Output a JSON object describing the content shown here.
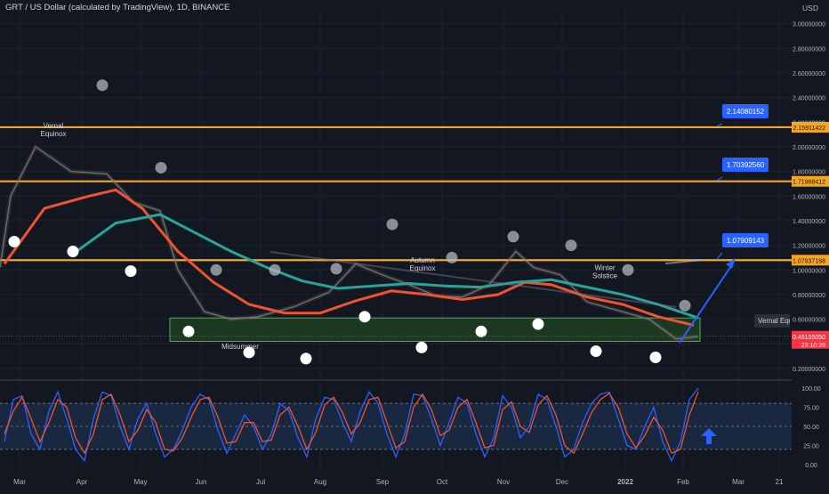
{
  "header": {
    "title": "GRT / US Dollar (calculated by TradingView), 1D, BINANCE",
    "currency": "USD"
  },
  "colors": {
    "background": "#131722",
    "resistance": "#f5a623",
    "callout": "#2962ff",
    "zone_fill": "#1e4620",
    "zone_border": "#4caf50",
    "ema_fast": "#f0532f",
    "ema_slow": "#26a69a",
    "stoch_k": "#2962ff",
    "stoch_d": "#f0532f",
    "stoch_band": "#1e2f4d",
    "price_tag": "#f23645"
  },
  "chart_data": [
    {
      "type": "line",
      "title": "GRT / US Dollar (calculated by TradingView), 1D, BINANCE",
      "xlabel": "",
      "ylabel": "",
      "x_tick_labels": [
        "Mar",
        "Apr",
        "May",
        "Jun",
        "Jul",
        "Aug",
        "Sep",
        "Oct",
        "Nov",
        "Dec",
        "2022",
        "Feb",
        "Mar",
        "21"
      ],
      "y_tick_labels": [
        "3.00000000",
        "2.80000000",
        "2.60000000",
        "2.40000000",
        "2.20000000",
        "2.00000000",
        "1.80000000",
        "1.60000000",
        "1.40000000",
        "1.20000000",
        "1.00000000",
        "0.80000000",
        "0.60000000",
        "0.40000000",
        "0.20000000"
      ],
      "ylim": [
        0.12,
        3.12
      ],
      "price_path": [
        [
          0,
          1.02
        ],
        [
          12,
          1.6
        ],
        [
          40,
          2.0
        ],
        [
          80,
          1.8
        ],
        [
          120,
          1.78
        ],
        [
          150,
          1.55
        ],
        [
          180,
          1.48
        ],
        [
          200,
          1.0
        ],
        [
          230,
          0.66
        ],
        [
          260,
          0.6
        ],
        [
          290,
          0.62
        ],
        [
          330,
          0.7
        ],
        [
          370,
          0.82
        ],
        [
          400,
          1.05
        ],
        [
          430,
          0.96
        ],
        [
          460,
          0.88
        ],
        [
          490,
          0.79
        ],
        [
          520,
          0.78
        ],
        [
          550,
          0.88
        ],
        [
          580,
          1.15
        ],
        [
          600,
          1.02
        ],
        [
          630,
          0.96
        ],
        [
          660,
          0.74
        ],
        [
          700,
          0.66
        ],
        [
          730,
          0.6
        ],
        [
          760,
          0.44
        ],
        [
          785,
          0.46
        ]
      ],
      "ema_fast_path": [
        [
          5,
          1.05
        ],
        [
          50,
          1.5
        ],
        [
          100,
          1.6
        ],
        [
          130,
          1.65
        ],
        [
          160,
          1.5
        ],
        [
          200,
          1.15
        ],
        [
          240,
          0.9
        ],
        [
          280,
          0.72
        ],
        [
          320,
          0.65
        ],
        [
          360,
          0.65
        ],
        [
          400,
          0.75
        ],
        [
          440,
          0.83
        ],
        [
          480,
          0.8
        ],
        [
          520,
          0.76
        ],
        [
          560,
          0.8
        ],
        [
          590,
          0.9
        ],
        [
          620,
          0.88
        ],
        [
          660,
          0.78
        ],
        [
          700,
          0.72
        ],
        [
          740,
          0.62
        ],
        [
          780,
          0.55
        ]
      ],
      "ema_slow_path": [
        [
          80,
          1.12
        ],
        [
          130,
          1.38
        ],
        [
          180,
          1.45
        ],
        [
          220,
          1.3
        ],
        [
          260,
          1.15
        ],
        [
          300,
          1.02
        ],
        [
          340,
          0.91
        ],
        [
          380,
          0.85
        ],
        [
          420,
          0.87
        ],
        [
          460,
          0.89
        ],
        [
          500,
          0.87
        ],
        [
          540,
          0.86
        ],
        [
          580,
          0.9
        ],
        [
          620,
          0.92
        ],
        [
          660,
          0.86
        ],
        [
          700,
          0.8
        ],
        [
          740,
          0.72
        ],
        [
          785,
          0.61
        ]
      ],
      "resistance_levels": [
        {
          "value": 2.15911422,
          "label": "2.15911422",
          "callout": "2.14080152"
        },
        {
          "value": 1.71968412,
          "label": "1.71968412",
          "callout": "1.70392560"
        },
        {
          "value": 1.07937168,
          "label": "1.07937168",
          "callout": "1.07909143"
        }
      ],
      "support_zone": [
        0.42,
        0.61
      ],
      "current_price": "0.46155050",
      "countdown": "23:10:39",
      "annotations": [
        {
          "text": "Vernal Equinox",
          "x": 60,
          "value": 2.15
        },
        {
          "text": "Midsummer",
          "x": 270,
          "value": 0.36
        },
        {
          "text": "Autumn Equinox",
          "x": 475,
          "value": 1.06
        },
        {
          "text": "Winter Solstice",
          "x": 680,
          "value": 1.0
        },
        {
          "text": "Vernal Equi",
          "x": 850,
          "value": 0.57
        }
      ],
      "full_moons": [
        [
          16,
          1.23
        ],
        [
          82,
          1.15
        ],
        [
          147,
          0.99
        ],
        [
          212,
          0.5
        ],
        [
          280,
          0.33
        ],
        [
          344,
          0.28
        ],
        [
          410,
          0.62
        ],
        [
          474,
          0.37
        ],
        [
          541,
          0.5
        ],
        [
          605,
          0.56
        ],
        [
          670,
          0.34
        ],
        [
          737,
          0.29
        ]
      ],
      "new_moons": [
        [
          115,
          2.5
        ],
        [
          181,
          1.83
        ],
        [
          243,
          1.0
        ],
        [
          309,
          1.0
        ],
        [
          378,
          1.01
        ],
        [
          441,
          1.37
        ],
        [
          508,
          1.1
        ],
        [
          577,
          1.27
        ],
        [
          642,
          1.2
        ],
        [
          706,
          1.0
        ],
        [
          770,
          0.71
        ]
      ]
    },
    {
      "type": "line",
      "title": "",
      "y_tick_labels": [
        "100.00",
        "75.00",
        "50.00",
        "25.00",
        "0.00"
      ],
      "ylim": [
        0,
        100
      ],
      "band": [
        20,
        80
      ],
      "series": [
        {
          "color": "#2962ff",
          "points": [
            [
              5,
              30
            ],
            [
              15,
              85
            ],
            [
              25,
              90
            ],
            [
              35,
              40
            ],
            [
              45,
              20
            ],
            [
              55,
              70
            ],
            [
              65,
              95
            ],
            [
              75,
              60
            ],
            [
              85,
              20
            ],
            [
              95,
              5
            ],
            [
              105,
              60
            ],
            [
              115,
              95
            ],
            [
              125,
              90
            ],
            [
              135,
              50
            ],
            [
              145,
              20
            ],
            [
              155,
              60
            ],
            [
              165,
              80
            ],
            [
              175,
              40
            ],
            [
              185,
              10
            ],
            [
              195,
              20
            ],
            [
              205,
              45
            ],
            [
              215,
              75
            ],
            [
              225,
              92
            ],
            [
              235,
              85
            ],
            [
              245,
              45
            ],
            [
              255,
              15
            ],
            [
              265,
              40
            ],
            [
              275,
              65
            ],
            [
              285,
              50
            ],
            [
              295,
              20
            ],
            [
              305,
              40
            ],
            [
              315,
              80
            ],
            [
              325,
              70
            ],
            [
              335,
              35
            ],
            [
              345,
              10
            ],
            [
              355,
              60
            ],
            [
              365,
              88
            ],
            [
              375,
              85
            ],
            [
              385,
              55
            ],
            [
              395,
              30
            ],
            [
              405,
              70
            ],
            [
              415,
              95
            ],
            [
              425,
              80
            ],
            [
              435,
              40
            ],
            [
              445,
              10
            ],
            [
              455,
              40
            ],
            [
              465,
              92
            ],
            [
              475,
              90
            ],
            [
              485,
              60
            ],
            [
              495,
              25
            ],
            [
              505,
              55
            ],
            [
              515,
              88
            ],
            [
              525,
              80
            ],
            [
              535,
              40
            ],
            [
              545,
              10
            ],
            [
              555,
              35
            ],
            [
              565,
              90
            ],
            [
              575,
              75
            ],
            [
              585,
              35
            ],
            [
              595,
              50
            ],
            [
              605,
              92
            ],
            [
              615,
              85
            ],
            [
              625,
              50
            ],
            [
              635,
              10
            ],
            [
              645,
              20
            ],
            [
              655,
              55
            ],
            [
              665,
              80
            ],
            [
              675,
              92
            ],
            [
              685,
              95
            ],
            [
              695,
              60
            ],
            [
              705,
              25
            ],
            [
              715,
              20
            ],
            [
              725,
              50
            ],
            [
              735,
              75
            ],
            [
              745,
              30
            ],
            [
              755,
              5
            ],
            [
              765,
              30
            ],
            [
              775,
              85
            ],
            [
              785,
              100
            ]
          ]
        },
        {
          "color": "#f0532f",
          "points": [
            [
              5,
              40
            ],
            [
              15,
              70
            ],
            [
              25,
              88
            ],
            [
              35,
              60
            ],
            [
              45,
              30
            ],
            [
              55,
              55
            ],
            [
              65,
              85
            ],
            [
              75,
              75
            ],
            [
              85,
              35
            ],
            [
              95,
              15
            ],
            [
              105,
              40
            ],
            [
              115,
              85
            ],
            [
              125,
              92
            ],
            [
              135,
              65
            ],
            [
              145,
              30
            ],
            [
              155,
              45
            ],
            [
              165,
              72
            ],
            [
              175,
              55
            ],
            [
              185,
              20
            ],
            [
              195,
              18
            ],
            [
              205,
              35
            ],
            [
              215,
              62
            ],
            [
              225,
              85
            ],
            [
              235,
              88
            ],
            [
              245,
              62
            ],
            [
              255,
              28
            ],
            [
              265,
              30
            ],
            [
              275,
              55
            ],
            [
              285,
              55
            ],
            [
              295,
              30
            ],
            [
              305,
              32
            ],
            [
              315,
              65
            ],
            [
              325,
              75
            ],
            [
              335,
              50
            ],
            [
              345,
              20
            ],
            [
              355,
              42
            ],
            [
              365,
              78
            ],
            [
              375,
              88
            ],
            [
              385,
              68
            ],
            [
              395,
              40
            ],
            [
              405,
              55
            ],
            [
              415,
              85
            ],
            [
              425,
              88
            ],
            [
              435,
              55
            ],
            [
              445,
              22
            ],
            [
              455,
              30
            ],
            [
              465,
              75
            ],
            [
              475,
              92
            ],
            [
              485,
              72
            ],
            [
              495,
              38
            ],
            [
              505,
              45
            ],
            [
              515,
              75
            ],
            [
              525,
              85
            ],
            [
              535,
              55
            ],
            [
              545,
              22
            ],
            [
              555,
              25
            ],
            [
              565,
              72
            ],
            [
              575,
              82
            ],
            [
              585,
              50
            ],
            [
              595,
              42
            ],
            [
              605,
              78
            ],
            [
              615,
              90
            ],
            [
              625,
              65
            ],
            [
              635,
              25
            ],
            [
              645,
              15
            ],
            [
              655,
              40
            ],
            [
              665,
              68
            ],
            [
              675,
              85
            ],
            [
              685,
              93
            ],
            [
              695,
              75
            ],
            [
              705,
              40
            ],
            [
              715,
              22
            ],
            [
              725,
              38
            ],
            [
              735,
              62
            ],
            [
              745,
              45
            ],
            [
              755,
              15
            ],
            [
              765,
              20
            ],
            [
              775,
              65
            ],
            [
              785,
              95
            ]
          ]
        }
      ]
    }
  ]
}
